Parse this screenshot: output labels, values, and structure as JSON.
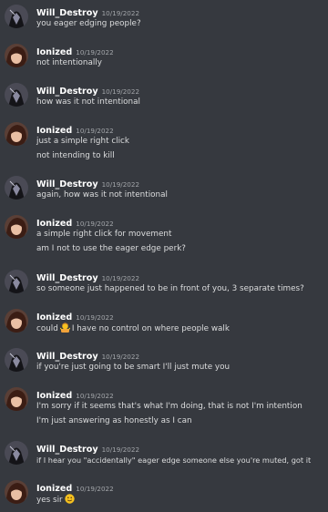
{
  "users": {
    "will": {
      "name": "Will_Destroy",
      "avatar_icon": "dark-hooded-figure-avatar-icon",
      "avatar_colors": {
        "bg": "#4a4a55",
        "dark": "#141418",
        "accent": "#8a8aa0"
      }
    },
    "ionized": {
      "name": "Ionized",
      "avatar_icon": "anime-character-avatar-icon",
      "avatar_colors": {
        "bg": "#5a3f36",
        "hair": "#3b1d14",
        "skin": "#e9bfa4"
      }
    }
  },
  "messages": [
    {
      "user": "Will_Destroy",
      "timestamp": "10/19/2022",
      "lines": [
        "you eager edging people?"
      ]
    },
    {
      "user": "Ionized",
      "timestamp": "10/19/2022",
      "lines": [
        "not intentionally"
      ]
    },
    {
      "user": "Will_Destroy",
      "timestamp": "10/19/2022",
      "lines": [
        "how was it not intentional"
      ]
    },
    {
      "user": "Ionized",
      "timestamp": "10/19/2022",
      "lines": [
        "just a simple right click",
        "not intending to kill"
      ]
    },
    {
      "user": "Will_Destroy",
      "timestamp": "10/19/2022",
      "lines": [
        "again, how was it not intentional"
      ]
    },
    {
      "user": "Ionized",
      "timestamp": "10/19/2022",
      "lines": [
        "a simple right click for movement",
        "am I not to use the eager edge perk?"
      ]
    },
    {
      "user": "Will_Destroy",
      "timestamp": "10/19/2022",
      "lines": [
        "so someone just happened to be in front of you, 3 separate times?"
      ]
    },
    {
      "user": "Ionized",
      "timestamp": "10/19/2022",
      "lines": [
        "could",
        "I have no control on where people walk"
      ],
      "emoji": "person-shrugging-emoji-icon"
    },
    {
      "user": "Will_Destroy",
      "timestamp": "10/19/2022",
      "lines": [
        "if you're just going to be smart I'll just mute you"
      ]
    },
    {
      "user": "Ionized",
      "timestamp": "10/19/2022",
      "lines": [
        "I'm sorry if it seems that's what I'm doing, that is not I'm intention",
        "I'm just answering as honestly as I can"
      ]
    },
    {
      "user": "Will_Destroy",
      "timestamp": "10/19/2022",
      "lines": [
        "if I hear you \"accidentally\" eager edge someone else you're muted, got it"
      ]
    },
    {
      "user": "Ionized",
      "timestamp": "10/19/2022",
      "lines": [
        "yes sir"
      ],
      "emoji": "slightly-smiling-face-emoji-icon"
    }
  ],
  "colors": {
    "background": "#36393f",
    "username": "#ffffff",
    "timestamp": "#a3a6aa",
    "message_text": "#dcddde",
    "emoji_yellow": "#f7c21f"
  }
}
